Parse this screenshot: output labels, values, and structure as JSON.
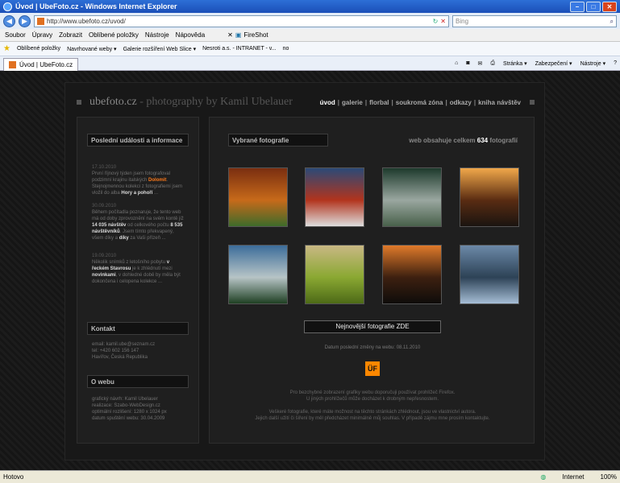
{
  "browser": {
    "window_title": "Úvod | UbeFoto.cz - Windows Internet Explorer",
    "address": "http://www.ubefoto.cz/uvod/",
    "search_placeholder": "Bing",
    "menu": [
      "Soubor",
      "Úpravy",
      "Zobrazit",
      "Oblíbené položky",
      "Nástroje",
      "Nápověda"
    ],
    "menu_extra": "FireShot",
    "favorites_label": "Oblíbené položky",
    "favorites": [
      "Navrhované weby ▾",
      "Galerie rozšíření Web Slice ▾",
      "Nesroti a.s. - INTRANET - v...",
      "no"
    ],
    "tab_title": "Úvod | UbeFoto.cz",
    "tools": [
      "Stránka ▾",
      "Zabezpečení ▾",
      "Nástroje ▾"
    ],
    "status_left": "Hotovo",
    "status_zone": "Internet",
    "zoom": "100%"
  },
  "site": {
    "logo": "ubefoto.cz",
    "logo_sub": " - photography by Kamil Ubelauer",
    "nav": [
      {
        "label": "úvod",
        "active": true
      },
      {
        "label": "galerie",
        "active": false
      },
      {
        "label": "florbal",
        "active": false
      },
      {
        "label": "soukromá zóna",
        "active": false
      },
      {
        "label": "odkazy",
        "active": false
      },
      {
        "label": "kniha návštěv",
        "active": false
      }
    ]
  },
  "sidebar": {
    "news_title": "Poslední události a informace",
    "news": [
      {
        "date": "17.10.2010",
        "t1": "První říjnový týden jsem fotografoval podzimní krajinu italských ",
        "b1": "Dolomit",
        "t2": ". Stejnojmennou kolekci z fotografiemi jsem vložil do alba ",
        "b2": "Hory a pohoří",
        "t3": " ..."
      },
      {
        "date": "30.09.2010",
        "t1": "Během počítadla pozna­ruje, že tento web má od doby zprovoznění na svém kontě již ",
        "b1": "14 035 návštěv",
        "t2": " od celkového počtu ",
        "b2": "8 535 návštěvníků",
        "t3": ". Jsem tímto překvapený, všem díky a ",
        "b3": "díky",
        "t4": " za Vaši přízeň ..."
      },
      {
        "date": "19.09.2010",
        "t1": "Několik snímků z letošního pobytu ",
        "b1": "v řeckém Stavrosu",
        "t2": " je k zhlédnutí mezi ",
        "b2": "novinkami",
        "t3": ", v dohledné době by měla být dokončena i celopena kolekce ..."
      }
    ],
    "contact_title": "Kontakt",
    "contact_lines": [
      "email: kamil.ube@seznam.cz",
      "tel: +420 602 156 147",
      "Havířov, Česká Republika"
    ],
    "about_title": "O webu",
    "about_lines": [
      "grafický návrh: Kamil Ubelauer",
      "realizace: Szabo-WebDesign.cz",
      "optimální rozlišení: 1280 x 1024 px",
      "datum spuštění webu: 30.04.2009"
    ]
  },
  "main": {
    "section_title": "Vybrané fotografie",
    "count_prefix": "web obsahuje celkem ",
    "count_value": "634",
    "count_suffix": " fotografií",
    "latest_button": "Nejnovější fotografie ZDE",
    "updated": "Datum poslední změny na webu: 08.11.2010",
    "badge": "ÜF",
    "notes": [
      "Pro bezchybné zobrazení grafiky webu doporučuji používat prohlížeč Firefox.",
      "U jiných prohlížečů může docházet k drobným nepřesnostem.",
      "Veškeré fotografie, které máte možnost na těchto stránkách zhlédnout, jsou ve vlastnictví autora.",
      "Jejich další užití či šíření by měl předcházet minimálně můj souhlas. V případě zájmu mne prosím kontaktujte."
    ],
    "photos": [
      {
        "name": "autumn-tree-photo",
        "colors": [
          "#7a2e10",
          "#c76a1a",
          "#3e6b2a"
        ]
      },
      {
        "name": "red-forest-sheep-photo",
        "colors": [
          "#2b4a77",
          "#b2341d",
          "#ddd"
        ]
      },
      {
        "name": "waterfall-photo",
        "colors": [
          "#1d3a2c",
          "#9aa7a0",
          "#48604a"
        ]
      },
      {
        "name": "sunset-coast-photo",
        "colors": [
          "#f1a84a",
          "#5a2c12",
          "#1a1410"
        ]
      },
      {
        "name": "mountain-peaks-photo",
        "colors": [
          "#3c6d9a",
          "#b7c4c6",
          "#1f4023"
        ]
      },
      {
        "name": "green-field-photo",
        "colors": [
          "#c9b883",
          "#8aa832",
          "#4d6a17"
        ]
      },
      {
        "name": "sunset-lake-photo",
        "colors": [
          "#e07a2a",
          "#3d2010",
          "#0e0c0a"
        ]
      },
      {
        "name": "river-valley-photo",
        "colors": [
          "#6c89a8",
          "#2d4256",
          "#a6bed6"
        ]
      }
    ]
  }
}
